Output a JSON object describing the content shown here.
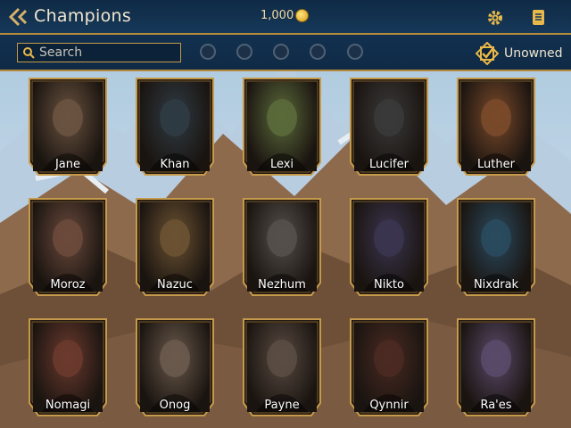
{
  "header": {
    "title": "Champions",
    "currency_amount": "1,000",
    "icons": {
      "back": "back-arrow-icon",
      "currency": "gold-coin-icon",
      "settings": "gear-icon",
      "log": "scroll-icon"
    }
  },
  "filters": {
    "search_placeholder": "Search",
    "runes": [
      "blue-rune-icon",
      "red-rune-icon",
      "green-rune-icon",
      "purple-rune-icon",
      "gray-rune-icon"
    ],
    "unowned_label": "Unowned"
  },
  "champions": [
    {
      "name": "Jane",
      "color": "#6a5340"
    },
    {
      "name": "Khan",
      "color": "#2f3b44"
    },
    {
      "name": "Lexi",
      "color": "#5b6a3a"
    },
    {
      "name": "Lucifer",
      "color": "#3a3a3a"
    },
    {
      "name": "Luther",
      "color": "#7a4a2a"
    },
    {
      "name": "Moroz",
      "color": "#6b4a3c"
    },
    {
      "name": "Nazuc",
      "color": "#6b5232"
    },
    {
      "name": "Nezhum",
      "color": "#55504c"
    },
    {
      "name": "Nikto",
      "color": "#3b3550"
    },
    {
      "name": "Nixdrak",
      "color": "#2a4a5e"
    },
    {
      "name": "Nomagi",
      "color": "#6b3a2e"
    },
    {
      "name": "Onog",
      "color": "#6a5a4c"
    },
    {
      "name": "Payne",
      "color": "#5a4c42"
    },
    {
      "name": "Qynnir",
      "color": "#4a2a22"
    },
    {
      "name": "Ra'es",
      "color": "#5a4a6a"
    }
  ],
  "colors": {
    "accent": "#b68a3b",
    "header_bg": "#0f2a45",
    "text": "#f1e6cf"
  }
}
